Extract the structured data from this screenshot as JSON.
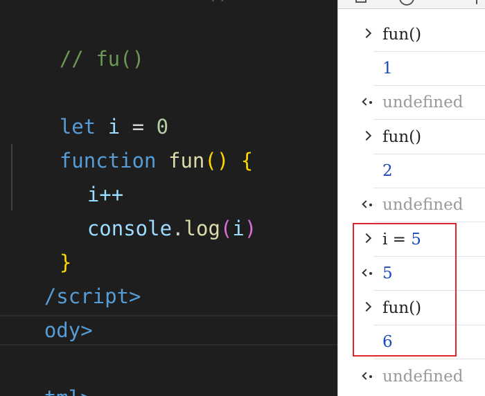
{
  "editor": {
    "lines": [
      {
        "id": "partial-top",
        "text": "                 ()  ."
      },
      {
        "id": "comment",
        "text": "// fu()"
      },
      {
        "id": "blank",
        "text": ""
      },
      {
        "id": "let",
        "kw": "let",
        "var": "i",
        "op": "=",
        "num": "0"
      },
      {
        "id": "function",
        "kw": "function",
        "fn": "fun",
        "paren": "()",
        "brace": "{"
      },
      {
        "id": "inc",
        "text": "i++"
      },
      {
        "id": "console-log",
        "obj": "console",
        "dot": ".",
        "fn": "log",
        "paren_open": "(",
        "arg": "i",
        "paren_close": ")"
      },
      {
        "id": "close-brace",
        "text": "}"
      },
      {
        "id": "script-close",
        "text": "/script>"
      },
      {
        "id": "body-close",
        "text": "ody>"
      },
      {
        "id": "blank2",
        "text": ""
      },
      {
        "id": "html-close",
        "text": "tml>"
      }
    ]
  },
  "console": {
    "entries": [
      {
        "kind": "input",
        "text": "fun()"
      },
      {
        "kind": "output",
        "text": "1"
      },
      {
        "kind": "return",
        "text": "undefined"
      },
      {
        "kind": "input",
        "text": "fun()"
      },
      {
        "kind": "output",
        "text": "2"
      },
      {
        "kind": "return",
        "text": "undefined"
      },
      {
        "kind": "input",
        "prefix": "i = ",
        "value": "5"
      },
      {
        "kind": "return-value",
        "text": "5"
      },
      {
        "kind": "input",
        "text": "fun()"
      },
      {
        "kind": "output",
        "text": "6"
      },
      {
        "kind": "return",
        "text": "undefined"
      }
    ]
  },
  "colors": {
    "highlight_box": "#e0252f",
    "editor_bg": "#1e1e1e",
    "console_bg": "#ffffff"
  }
}
